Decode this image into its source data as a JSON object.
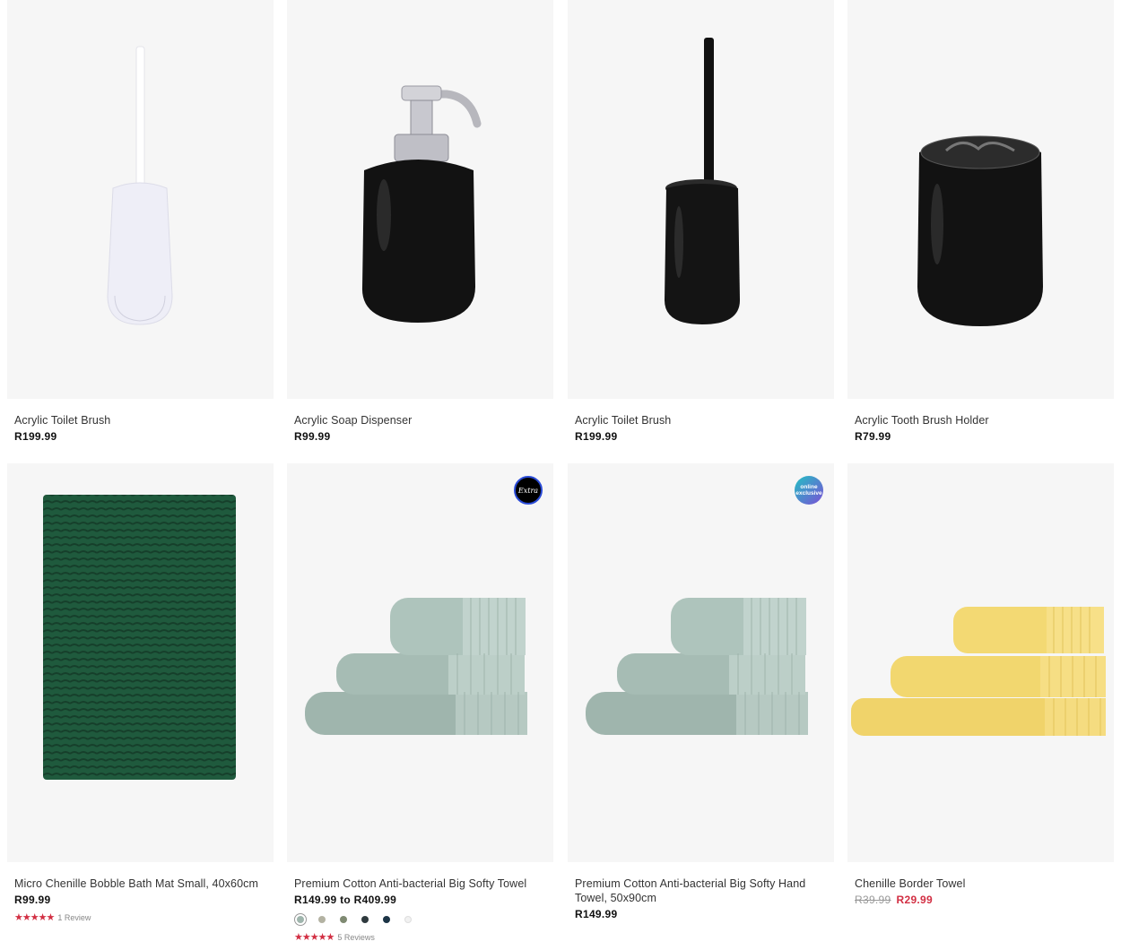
{
  "products": [
    {
      "name": "Acrylic Toilet Brush",
      "price": "R199.99"
    },
    {
      "name": "Acrylic Soap Dispenser",
      "price": "R99.99"
    },
    {
      "name": "Acrylic Toilet Brush",
      "price": "R199.99"
    },
    {
      "name": "Acrylic Tooth Brush Holder",
      "price": "R79.99"
    },
    {
      "name": "Micro Chenille Bobble Bath Mat Small, 40x60cm",
      "price": "R99.99",
      "stars": "★★★★★",
      "reviews": "1 Review",
      "rating": 5
    },
    {
      "name": "Premium Cotton Anti-bacterial Big Softy Towel",
      "price": "R149.99 to R409.99",
      "stars": "★★★★★",
      "reviews": "5 Reviews",
      "rating": 5,
      "badge": "Extra",
      "swatches": [
        "#9fb5ad",
        "#b3b2a2",
        "#7f8a72",
        "#2f3a3e",
        "#1c3446",
        "#f1f1f1"
      ]
    },
    {
      "name": "Premium Cotton Anti-bacterial Big Softy Hand Towel, 50x90cm",
      "price": "R149.99",
      "badge_line1": "online",
      "badge_line2": "exclusive"
    },
    {
      "name": "Chenille Border Towel",
      "old_price": "R39.99",
      "sale_price": "R29.99"
    }
  ],
  "colors": {
    "sale": "#d22f43",
    "card_bg": "#f6f6f6"
  },
  "icons": [
    "star-icon",
    "color-swatch"
  ]
}
